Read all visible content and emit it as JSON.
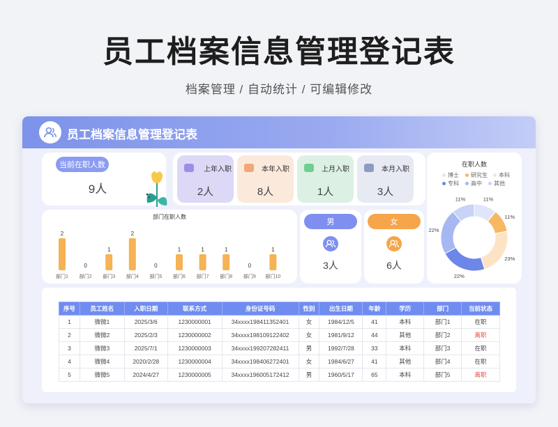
{
  "hero": {
    "title": "员工档案信息管理登记表",
    "subtitle": "档案管理 / 自动统计 /  可编辑修改"
  },
  "banner": {
    "title": "员工档案信息管理登记表"
  },
  "current_card": {
    "label": "当前在职人数",
    "value": "9人"
  },
  "stats": [
    {
      "label": "上年入职",
      "value": "2人",
      "bg": "#ddd8f5",
      "icon_color": "#9b8fe6"
    },
    {
      "label": "本年入职",
      "value": "8人",
      "bg": "#fbe9dc",
      "icon_color": "#f0a878"
    },
    {
      "label": "上月入职",
      "value": "1人",
      "bg": "#dcf1e3",
      "icon_color": "#6fcf93"
    },
    {
      "label": "本月入职",
      "value": "3人",
      "bg": "#e7eaf3",
      "icon_color": "#8d9bc4"
    }
  ],
  "gender": {
    "male": {
      "label": "男",
      "value": "3人",
      "color": "#7e8ff0"
    },
    "female": {
      "label": "女",
      "value": "6人",
      "color": "#f6a54a"
    }
  },
  "chart_data": [
    {
      "type": "bar",
      "title": "部门在职人数",
      "categories": [
        "部门1",
        "部门2",
        "部门3",
        "部门4",
        "部门5",
        "部门6",
        "部门7",
        "部门8",
        "部门9",
        "部门10"
      ],
      "values": [
        2,
        0,
        1,
        2,
        0,
        1,
        1,
        1,
        0,
        1
      ],
      "ylim": [
        0,
        2
      ],
      "color": "#f6b255",
      "grid": false
    },
    {
      "type": "pie",
      "title": "在职人数",
      "legend_position": "top",
      "labels": [
        "博士",
        "研究生",
        "本科",
        "专科",
        "高中",
        "其他"
      ],
      "values": [
        11,
        11,
        23,
        22,
        22,
        11
      ],
      "value_labels": [
        "11%",
        "11%",
        "23%",
        "22%",
        "22%",
        "11%"
      ],
      "colors": [
        "#dfe6fb",
        "#f6b861",
        "#fde3c6",
        "#6d86ea",
        "#a6b7f2",
        "#c9d3f7"
      ]
    }
  ],
  "table": {
    "headers": [
      "序号",
      "员工姓名",
      "入职日期",
      "联系方式",
      "身份证号码",
      "性别",
      "出生日期",
      "年龄",
      "学历",
      "部门",
      "当前状态"
    ],
    "rows": [
      [
        "1",
        "微微1",
        "2025/3/6",
        "1230000001",
        "34xxxx198411352401",
        "女",
        "1984/12/5",
        "41",
        "本科",
        "部门1",
        "在职"
      ],
      [
        "2",
        "微微2",
        "2025/2/3",
        "1230000002",
        "34xxxx198109122402",
        "女",
        "1981/9/12",
        "44",
        "其他",
        "部门2",
        "离职"
      ],
      [
        "3",
        "微微3",
        "2025/7/1",
        "1230000003",
        "34xxxx199207282411",
        "男",
        "1992/7/28",
        "33",
        "本科",
        "部门3",
        "在职"
      ],
      [
        "4",
        "微微4",
        "2020/2/28",
        "1230000004",
        "34xxxx198406272401",
        "女",
        "1984/6/27",
        "41",
        "其他",
        "部门4",
        "在职"
      ],
      [
        "5",
        "微微5",
        "2024/4/27",
        "1230000005",
        "34xxxx196005172412",
        "男",
        "1960/5/17",
        "65",
        "本科",
        "部门5",
        "离职"
      ]
    ]
  }
}
